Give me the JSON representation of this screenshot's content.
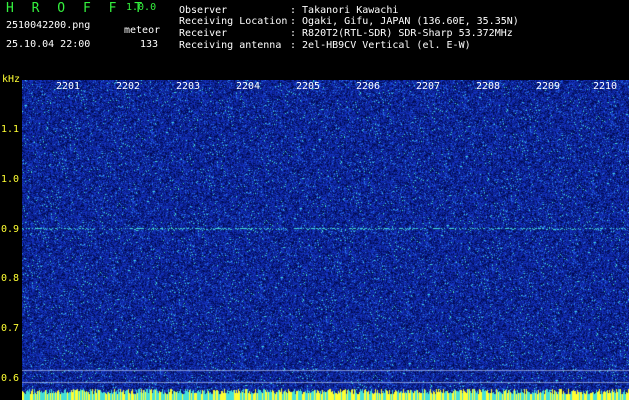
{
  "header": {
    "app_title": "H R O F F T",
    "app_version": "1.0.0",
    "file_name": "2510042200.png",
    "meteor_label": "meteor",
    "datetime": "25.10.04 22:00",
    "meteor_count": "133"
  },
  "info": [
    {
      "label": "Observer",
      "value": ": Takanori Kawachi"
    },
    {
      "label": "Receiving Location",
      "value": ": Ogaki, Gifu, JAPAN (136.60E, 35.35N)"
    },
    {
      "label": "Receiver",
      "value": ": R820T2(RTL-SDR) SDR-Sharp 53.372MHz"
    },
    {
      "label": "Receiving antenna",
      "value": ": 2el-HB9CV Vertical (el. E-W)"
    }
  ],
  "axis": {
    "y_unit": "kHz",
    "y_ticks": [
      "1.1",
      "1.0",
      "0.9",
      "0.8",
      "0.7",
      "0.6"
    ],
    "x_ticks": [
      "2201",
      "2202",
      "2203",
      "2204",
      "2205",
      "2206",
      "2207",
      "2208",
      "2209",
      "2210"
    ]
  },
  "colors": {
    "background": "#000000",
    "spectrogram_base": "#0a1f8a",
    "title_green": "#34f23e",
    "tick_yellow": "#ffff33",
    "signal_cyan": "#44e0d8",
    "text_white": "#ffffff"
  }
}
